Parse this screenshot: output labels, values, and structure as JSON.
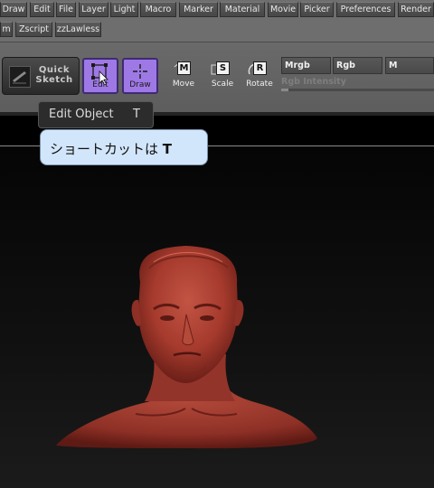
{
  "menu": {
    "row1": [
      "Draw",
      "Edit",
      "File",
      "Layer",
      "Light",
      "Macro",
      "Marker",
      "Material",
      "Movie",
      "Picker",
      "Preferences",
      "Render"
    ],
    "row2": [
      "m",
      "Zscript",
      "zzLawless"
    ]
  },
  "shelf": {
    "quick_sketch_line1": "Quick",
    "quick_sketch_line2": "Sketch",
    "edit_label": "Edit",
    "draw_label": "Draw",
    "move_label": "Move",
    "move_letter": "M",
    "scale_label": "Scale",
    "scale_letter": "S",
    "rotate_label": "Rotate",
    "rotate_letter": "R",
    "mrgb_label": "Mrgb",
    "rgb_label": "Rgb",
    "m_label": "M",
    "rgb_intensity_label": "Rgb Intensity",
    "rgb_intensity_fill": 0.05
  },
  "tooltip": {
    "name": "Edit Object",
    "key": "T",
    "hint_prefix": "ショートカットは",
    "hint_key": "T"
  },
  "colors": {
    "active_tool": "#9e79e5",
    "tooltip_bubble": "#d2e6fb",
    "model_clay": "#a53a2d"
  }
}
